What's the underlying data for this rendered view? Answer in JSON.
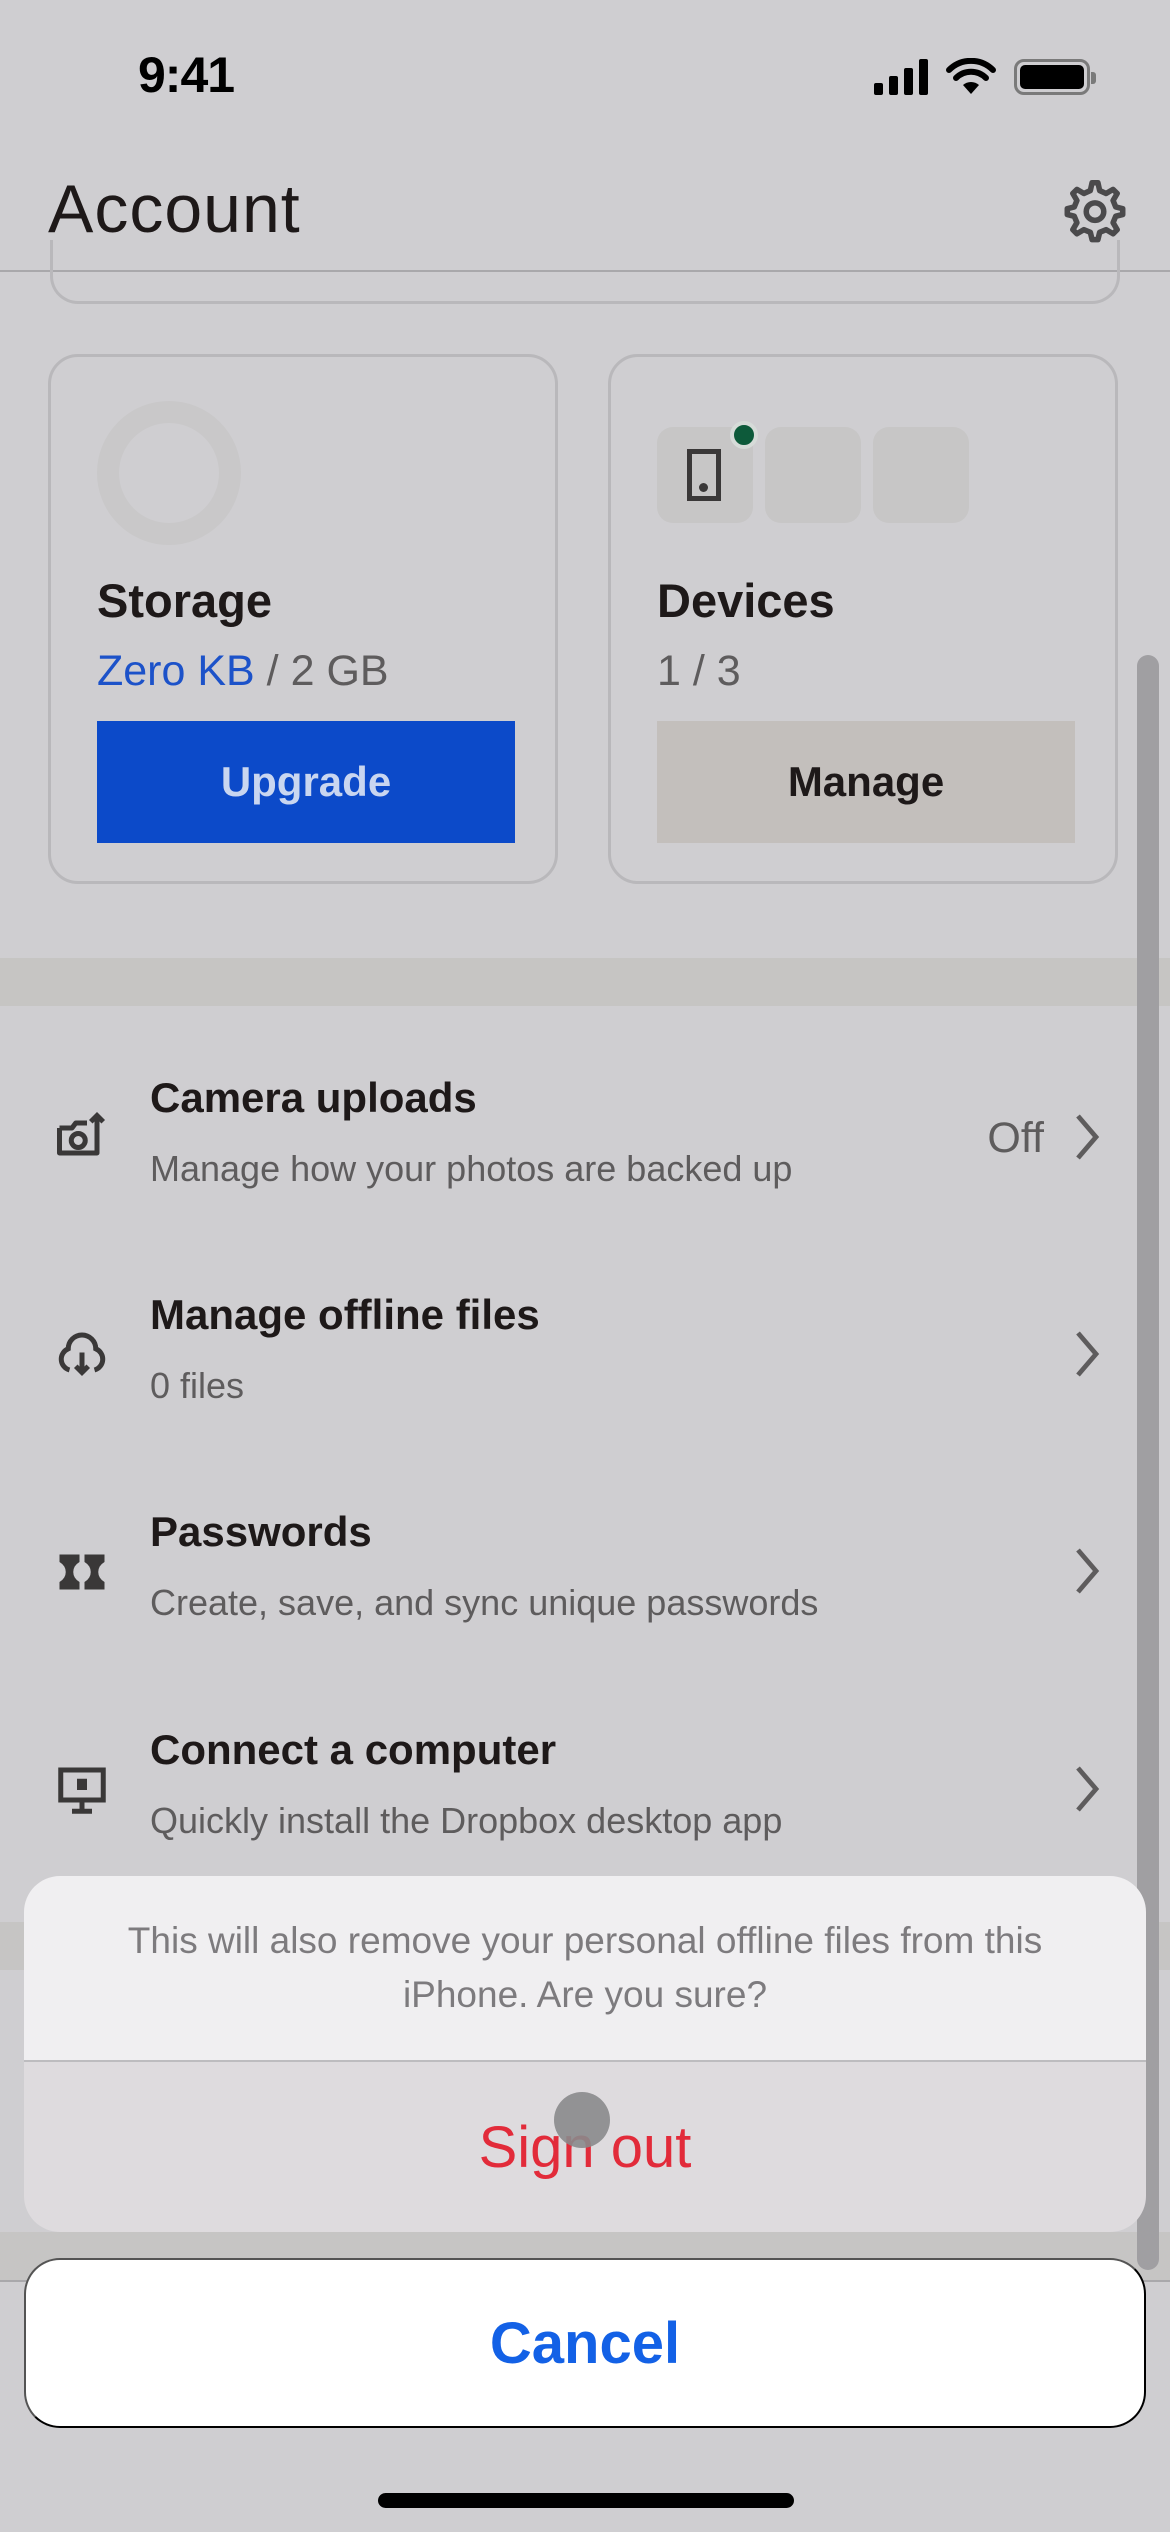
{
  "status_bar": {
    "time": "9:41",
    "icons": [
      "cellular-signal-icon",
      "wifi-icon",
      "battery-icon"
    ]
  },
  "header": {
    "title": "Account",
    "settings_icon": "gear-icon"
  },
  "storage_card": {
    "title": "Storage",
    "used": "Zero KB",
    "separator": " / ",
    "total": "2 GB",
    "button_label": "Upgrade",
    "ring_icon": "storage-usage-ring-icon"
  },
  "devices_card": {
    "title": "Devices",
    "count": "1 / 3",
    "connected": 1,
    "limit": 3,
    "button_label": "Manage",
    "device_icon": "phone-icon",
    "status_color": "#0d5a3a"
  },
  "list": {
    "items": [
      {
        "title": "Camera uploads",
        "subtitle": "Manage how your photos are backed up",
        "value": "Off",
        "icon": "camera-upload-icon"
      },
      {
        "title": "Manage offline files",
        "subtitle": "0 files",
        "value": "",
        "icon": "cloud-download-icon"
      },
      {
        "title": "Passwords",
        "subtitle": "Create, save, and sync unique passwords",
        "value": "",
        "icon": "passwords-icon"
      },
      {
        "title": "Connect a computer",
        "subtitle": "Quickly install the Dropbox desktop app",
        "value": "",
        "icon": "desktop-computer-icon"
      }
    ]
  },
  "action_sheet": {
    "message": "This will also remove your personal offline files from this iPhone. Are you sure?",
    "destructive_label": "Sign out",
    "cancel_label": "Cancel"
  },
  "colors": {
    "accent_blue": "#0c4ac9",
    "link_blue": "#1c52c9",
    "destructive_red": "#e22b3a",
    "cancel_blue": "#1361e6"
  }
}
